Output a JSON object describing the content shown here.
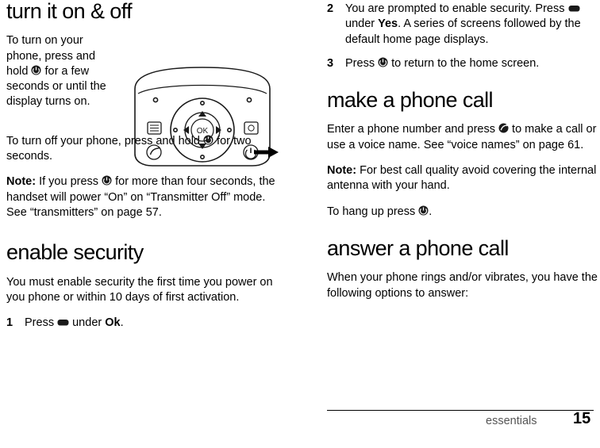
{
  "document": {
    "page_number": "15",
    "footer_label": "essentials"
  },
  "left_column": {
    "section_title": "turn it on & off",
    "paragraph_1_a": "To turn on your phone, press and hold ",
    "paragraph_1_b": " for a few seconds or until the display turns on.",
    "paragraph_2_a": "To turn off your phone, press and hold ",
    "paragraph_2_b": " for two seconds.",
    "note_label": "Note:",
    "note_a": " If you press ",
    "note_b": " for more than four seconds, the handset will power “On” on “Transmitter Off” mode. See “transmitters” on page 57.",
    "section_title_2": "enable security",
    "paragraph_3": "You must enable security the first time you power on you phone or within 10 days of first activation.",
    "step_1": {
      "num": "1",
      "text_a": "Press ",
      "text_b": " under ",
      "emph": "Ok",
      "text_c": "."
    },
    "illustration": {
      "name": "phone-keypad-illustration",
      "ok_label": "OK"
    }
  },
  "right_column": {
    "step_2": {
      "num": "2",
      "text_a": "You are prompted to enable security. Press ",
      "text_b": " under ",
      "emph": "Yes",
      "text_c": ". A series of screens followed by the default home page displays."
    },
    "step_3": {
      "num": "3",
      "text_a": "Press ",
      "text_b": " to return to the home screen."
    },
    "section_title": "make a phone call",
    "paragraph_1_a": "Enter a phone number and press ",
    "paragraph_1_b": " to make a call or use a voice name. See “voice names” on page 61.",
    "note_label": "Note:",
    "note_text": " For best call quality avoid covering the internal antenna with your hand.",
    "paragraph_2_a": "To hang up press ",
    "paragraph_2_b": ".",
    "section_title_2": "answer a phone call",
    "paragraph_3": "When your phone rings and/or vibrates, you have the following options to answer:"
  },
  "icons": {
    "power_key": "power-key-icon",
    "soft_key": "soft-key-icon",
    "end_key": "end-key-icon",
    "send_key": "send-key-icon"
  },
  "colors": {
    "text": "#000000",
    "footer_label": "#555555",
    "illustration_line": "#1a1a1a"
  }
}
